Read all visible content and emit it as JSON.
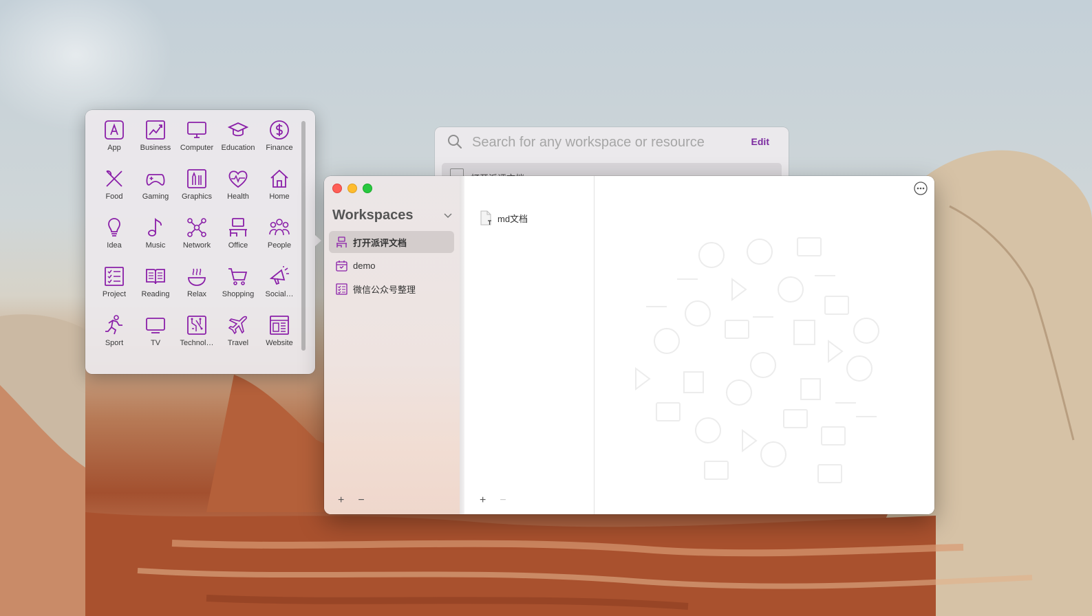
{
  "icon_picker": {
    "items": [
      {
        "label": "App",
        "icon": "app-icon"
      },
      {
        "label": "Business",
        "icon": "business-chart-icon"
      },
      {
        "label": "Computer",
        "icon": "computer-icon"
      },
      {
        "label": "Education",
        "icon": "graduation-cap-icon"
      },
      {
        "label": "Finance",
        "icon": "dollar-icon"
      },
      {
        "label": "Food",
        "icon": "fork-knife-icon"
      },
      {
        "label": "Gaming",
        "icon": "gamepad-icon"
      },
      {
        "label": "Graphics",
        "icon": "graphics-tools-icon"
      },
      {
        "label": "Health",
        "icon": "heart-pulse-icon"
      },
      {
        "label": "Home",
        "icon": "house-icon"
      },
      {
        "label": "Idea",
        "icon": "lightbulb-icon"
      },
      {
        "label": "Music",
        "icon": "music-note-icon"
      },
      {
        "label": "Network",
        "icon": "network-icon"
      },
      {
        "label": "Office",
        "icon": "office-desk-icon"
      },
      {
        "label": "People",
        "icon": "people-icon"
      },
      {
        "label": "Project",
        "icon": "checklist-icon"
      },
      {
        "label": "Reading",
        "icon": "open-book-icon"
      },
      {
        "label": "Relax",
        "icon": "hot-bowl-icon"
      },
      {
        "label": "Shopping",
        "icon": "shopping-cart-icon"
      },
      {
        "label": "Social…",
        "icon": "megaphone-icon"
      },
      {
        "label": "Sport",
        "icon": "runner-icon"
      },
      {
        "label": "TV",
        "icon": "tv-icon"
      },
      {
        "label": "Technol…",
        "icon": "circuit-icon"
      },
      {
        "label": "Travel",
        "icon": "airplane-icon"
      },
      {
        "label": "Website",
        "icon": "webpage-icon"
      }
    ],
    "accent": "#8a1fa8"
  },
  "search_panel": {
    "placeholder": "Search for any workspace or resource",
    "edit_label": "Edit",
    "first_result": "打开派评文档"
  },
  "window": {
    "sidebar": {
      "title": "Workspaces",
      "workspaces": [
        {
          "label": "打开派评文档",
          "icon": "desk-icon",
          "selected": true
        },
        {
          "label": "demo",
          "icon": "calendar-icon",
          "selected": false
        },
        {
          "label": "微信公众号整理",
          "icon": "checklist-icon",
          "selected": false
        }
      ],
      "add_label": "+",
      "remove_label": "−"
    },
    "resources": {
      "items": [
        {
          "label": "md文档",
          "icon": "text-document-icon"
        }
      ],
      "add_label": "+",
      "remove_label": "−"
    }
  }
}
